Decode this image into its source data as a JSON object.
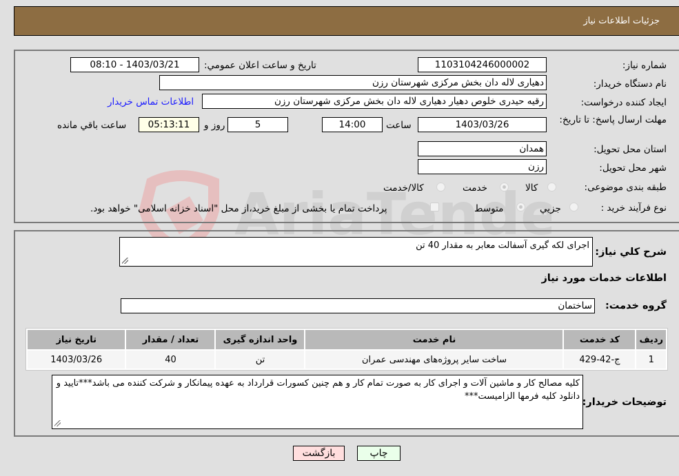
{
  "header": {
    "title": "جزئیات اطلاعات نیاز"
  },
  "details": {
    "need_number_label": "شماره نیاز:",
    "need_number": "1103104246000002",
    "announce_label": "تاریخ و ساعت اعلان عمومي:",
    "announce_value": "1403/03/21 - 08:10",
    "buyer_org_label": "نام دستگاه خریدار:",
    "buyer_org": "دهیاری لاله دان بخش مرکزی شهرستان رزن",
    "creator_label": "ایجاد کننده درخواست:",
    "creator": "رقیه حیدری خلوص دهیار دهیاری لاله دان بخش مرکزی شهرستان رزن",
    "contact_link": "اطلاعات تماس خریدار",
    "deadline_label": "مهلت ارسال پاسخ: تا تاریخ:",
    "deadline_date": "1403/03/26",
    "time_label": "ساعت",
    "deadline_time": "14:00",
    "days": "5",
    "days_label": "روز و",
    "remaining_time": "05:13:11",
    "remaining_label": "ساعت باقي مانده",
    "province_label": "استان محل تحویل:",
    "province": "همدان",
    "city_label": "شهر محل تحویل:",
    "city": "رزن",
    "category_label": "طبقه بندی موضوعی:",
    "category_options": [
      {
        "label": "کالا",
        "selected": false
      },
      {
        "label": "خدمت",
        "selected": true
      },
      {
        "label": "کالا/خدمت",
        "selected": false
      }
    ],
    "process_label": "نوع فرآیند خرید :",
    "process_options": [
      {
        "label": "جزيي",
        "selected": false
      },
      {
        "label": "متوسط",
        "selected": true
      }
    ],
    "treasury_note": "پرداخت تمام یا بخشی از مبلغ خرید،از محل \"اسناد خزانه اسلامی\" خواهد بود.",
    "treasury_checked": false
  },
  "summary": {
    "description_label": "شرح کلي نیاز:",
    "description": "اجرای لکه گیری آسفالت معابر به مقدار 40 تن",
    "services_heading": "اطلاعات خدمات مورد نیاز",
    "service_group_label": "گروه خدمت:",
    "service_group": "ساختمان"
  },
  "table": {
    "headers": [
      "ردیف",
      "کد خدمت",
      "نام خدمت",
      "واحد اندازه گیری",
      "تعداد / مقدار",
      "تاریخ نیاز"
    ],
    "rows": [
      [
        "1",
        "ج-42-429",
        "ساخت سایر پروژه‌های مهندسی عمران",
        "تن",
        "40",
        "1403/03/26"
      ]
    ]
  },
  "buyer_notes": {
    "label": "توضیحات خریدار:",
    "text": "کلیه مصالح کار و ماشین آلات و اجرای کار به صورت تمام کار و هم چنین کسورات قرارداد به عهده پیمانکار و شرکت کننده می باشد***تایید و دانلود کلیه فرمها الزامیست***"
  },
  "buttons": {
    "print": "چاپ",
    "back": "بازگشت"
  },
  "watermark": {
    "text": "AriaTender.neT",
    "accent": "#e8b4b4",
    "gray": "#c4c4c4"
  },
  "colors": {
    "header_bg": "#8d6d42",
    "print_bg": "#eaffea",
    "back_bg": "#ffdede",
    "remaining_bg": "#ffffe8"
  }
}
